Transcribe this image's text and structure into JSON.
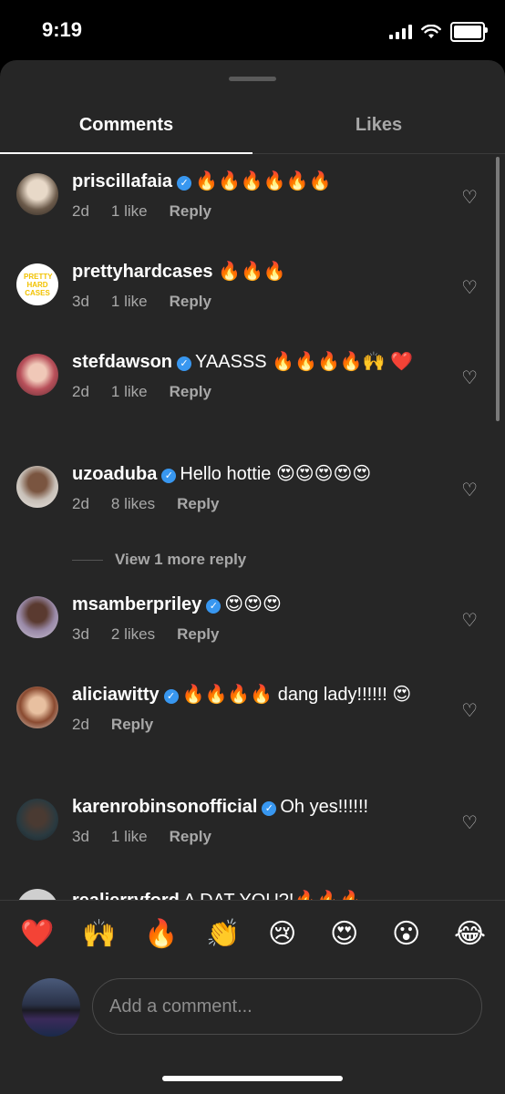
{
  "status": {
    "time": "9:19"
  },
  "tabs": {
    "comments": "Comments",
    "likes": "Likes"
  },
  "comments": [
    {
      "username": "priscillafaia",
      "verified": true,
      "text": "🔥🔥🔥🔥🔥🔥",
      "age": "2d",
      "likes": "1 like",
      "reply": "Reply"
    },
    {
      "username": "prettyhardcases",
      "verified": false,
      "text": "🔥🔥🔥",
      "age": "3d",
      "likes": "1 like",
      "reply": "Reply",
      "avatar_text": "PRETTY HARD CASES"
    },
    {
      "username": "stefdawson",
      "verified": true,
      "text": "YAASSS 🔥🔥🔥🔥🙌 ❤️",
      "age": "2d",
      "likes": "1 like",
      "reply": "Reply"
    },
    {
      "username": "uzoaduba",
      "verified": true,
      "text": "Hello hottie 😍😍😍😍😍",
      "age": "2d",
      "likes": "8 likes",
      "reply": "Reply"
    },
    {
      "username": "msamberpriley",
      "verified": true,
      "text": "😍😍😍",
      "age": "3d",
      "likes": "2 likes",
      "reply": "Reply"
    },
    {
      "username": "aliciawitty",
      "verified": true,
      "text": "🔥🔥🔥🔥 dang lady!!!!!! 😍",
      "age": "2d",
      "likes": "",
      "reply": "Reply"
    },
    {
      "username": "karenrobinsonofficial",
      "verified": true,
      "text": "Oh yes!!!!!!",
      "age": "3d",
      "likes": "1 like",
      "reply": "Reply"
    },
    {
      "username": "realjerryford",
      "verified": false,
      "text": "A DAT YOU?!🔥🔥🔥"
    }
  ],
  "view_more": "View 1 more reply",
  "emoji_bar": [
    "❤️",
    "🙌",
    "🔥",
    "👏",
    "😢",
    "😍",
    "😮",
    "😂"
  ],
  "input": {
    "placeholder": "Add a comment..."
  },
  "colors": {
    "sheet": "#262626",
    "verified": "#3897f0",
    "muted": "#a8a8a8"
  }
}
